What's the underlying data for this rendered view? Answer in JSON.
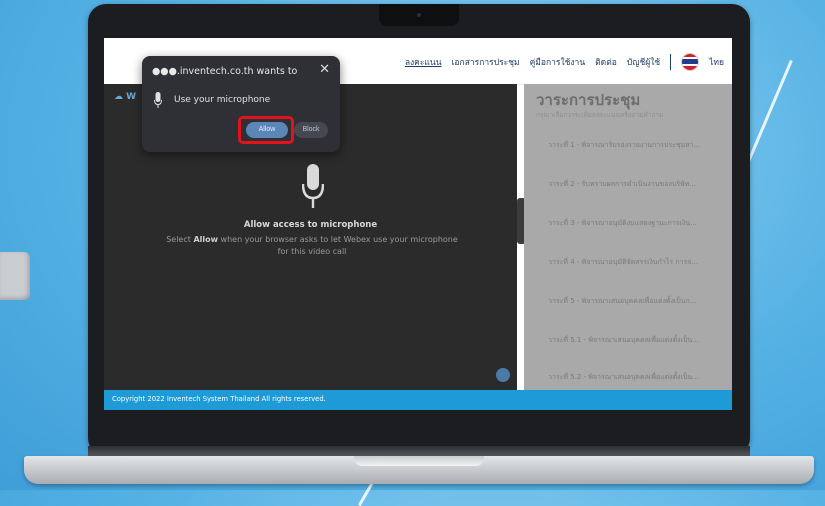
{
  "popup": {
    "host": "●●●.inventech.co.th  wants to",
    "close_label": "✕",
    "permission": "Use your microphone",
    "allow_label": "Allow",
    "block_label": "Block"
  },
  "nav": {
    "items": [
      "ลงคะแนน",
      "เอกสารการประชุม",
      "คู่มือการใช้งาน",
      "ติดต่อ",
      "บัญชีผู้ใช้"
    ],
    "language": "ไทย"
  },
  "video": {
    "logo": "W",
    "mic_title": "Allow access to microphone",
    "mic_sub_prefix": "Select ",
    "mic_sub_bold": "Allow",
    "mic_sub_rest": " when your browser asks to let Webex use your microphone for this video call"
  },
  "agenda": {
    "title": "วาระการประชุม",
    "subtitle": "กรุณาเลือกวาระเพื่อลงคะแนนหรือถามคำถาม",
    "items": [
      "วาระที่ 1 - พิจารณารับรองรายงานการประชุมสา...",
      "วาระที่ 2 - รับทราบผลการดำเนินงานของบริษัท...",
      "วาระที่ 3 - พิจารณาอนุมัติงบแสดงฐานะการเงิน...",
      "วาระที่ 4 - พิจารณาอนุมัติจัดสรรเงินกำไร การจ่...",
      "วาระที่ 5 - พิจารณาเสนอบุคคลเพื่อแต่งตั้งเป็นก...",
      "วาระที่ 5.1 - พิจารณาเสนอบุคคลเพื่อแต่งตั้งเป็น...",
      "วาระที่ 5.2 - พิจารณาเสนอบุคคลเพื่อแต่งตั้งเป็น..."
    ]
  },
  "footer": {
    "copyright": "Copyright  2022 Inventech System Thailand All rights reserved."
  },
  "colors": {
    "footer": "#1e9bd7",
    "allow_button": "#5c86b8",
    "highlight": "#e3121b",
    "background": "#56b2e4"
  }
}
